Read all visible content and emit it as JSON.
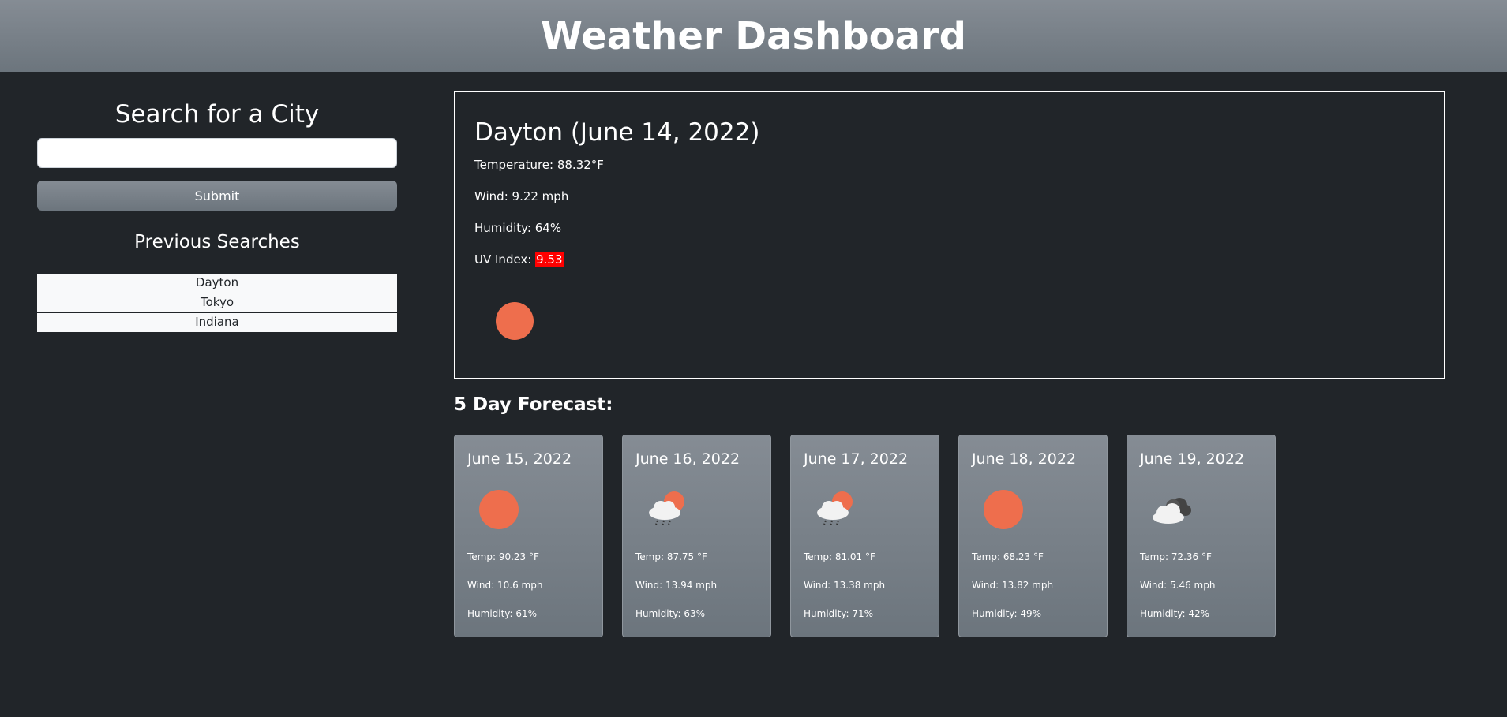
{
  "header": {
    "title": "Weather Dashboard"
  },
  "sidebar": {
    "title": "Search for a City",
    "search_value": "",
    "submit_label": "Submit",
    "previous_title": "Previous Searches",
    "previous": [
      "Dayton",
      "Tokyo",
      "Indiana"
    ]
  },
  "current": {
    "title": "Dayton (June 14, 2022)",
    "temperature": "Temperature: 88.32°F",
    "wind": "Wind: 9.22 mph",
    "humidity": "Humidity: 64%",
    "uv_label": "UV Index: ",
    "uv_value": "9.53",
    "uv_color": "#ff0000",
    "icon": "sun-icon"
  },
  "forecast": {
    "title": "5 Day Forecast:",
    "days": [
      {
        "date": "June 15, 2022",
        "icon": "sun-icon",
        "temp": "Temp: 90.23 °F",
        "wind": "Wind: 10.6 mph",
        "humidity": "Humidity: 61%"
      },
      {
        "date": "June 16, 2022",
        "icon": "sun-rain-cloud-icon",
        "temp": "Temp: 87.75 °F",
        "wind": "Wind: 13.94 mph",
        "humidity": "Humidity: 63%"
      },
      {
        "date": "June 17, 2022",
        "icon": "sun-rain-cloud-icon",
        "temp": "Temp: 81.01 °F",
        "wind": "Wind: 13.38 mph",
        "humidity": "Humidity: 71%"
      },
      {
        "date": "June 18, 2022",
        "icon": "sun-icon",
        "temp": "Temp: 68.23 °F",
        "wind": "Wind: 13.82 mph",
        "humidity": "Humidity: 49%"
      },
      {
        "date": "June 19, 2022",
        "icon": "broken-clouds-icon",
        "temp": "Temp: 72.36 °F",
        "wind": "Wind: 5.46 mph",
        "humidity": "Humidity: 42%"
      }
    ]
  },
  "colors": {
    "background": "#212529",
    "header": "#6c757d",
    "sun": "#ee6e4d",
    "uv_high": "#ff0000"
  }
}
